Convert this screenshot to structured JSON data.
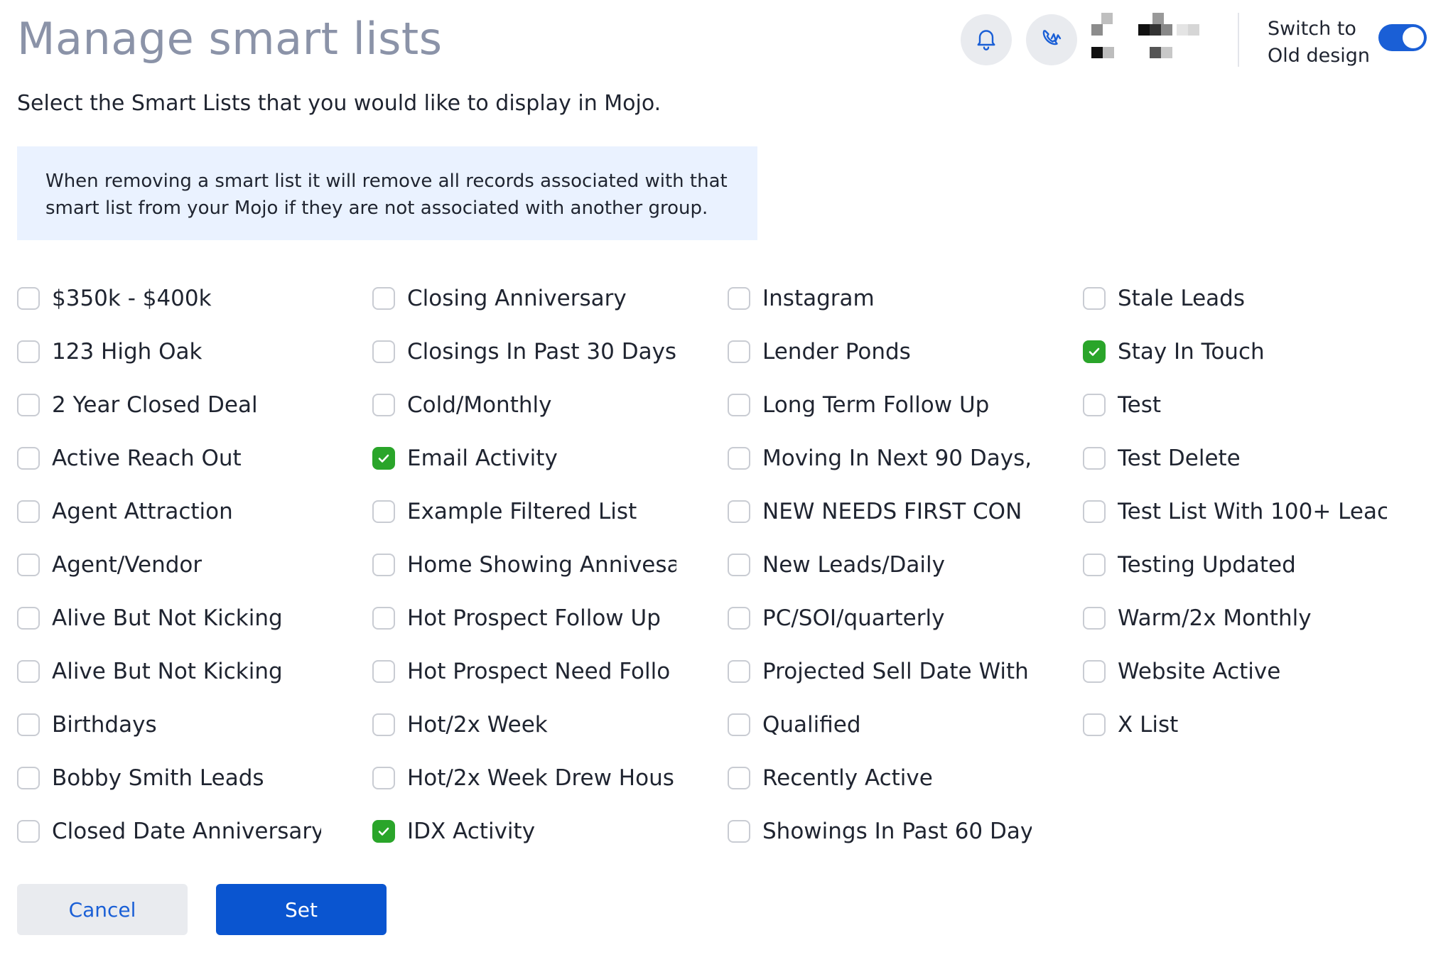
{
  "header": {
    "title": "Manage smart lists",
    "switch_label": "Switch to Old design",
    "toggle_on": true
  },
  "subtitle": "Select the Smart Lists that you would like to display in Mojo.",
  "info_text": "When removing a smart list it will remove all records associated with that smart list from your Mojo if they are not associated with another group.",
  "icons": {
    "bell": "bell-icon",
    "phone": "phone-wave-icon",
    "check": "check-icon"
  },
  "colors": {
    "accent": "#1a5fd6",
    "checked": "#2aa52a",
    "info_bg": "#eaf2ff"
  },
  "lists": {
    "columns": [
      [
        {
          "label": "$350k - $400k",
          "checked": false
        },
        {
          "label": "123 High Oak",
          "checked": false
        },
        {
          "label": "2 Year Closed Deal",
          "checked": false
        },
        {
          "label": "Active Reach Out",
          "checked": false
        },
        {
          "label": "Agent Attraction",
          "checked": false
        },
        {
          "label": "Agent/Vendor",
          "checked": false
        },
        {
          "label": "Alive But Not Kicking",
          "checked": false
        },
        {
          "label": "Alive But Not Kicking",
          "checked": false
        },
        {
          "label": "Birthdays",
          "checked": false
        },
        {
          "label": "Bobby Smith Leads",
          "checked": false
        },
        {
          "label": "Closed Date Anniversary",
          "checked": false
        }
      ],
      [
        {
          "label": "Closing Anniversary",
          "checked": false
        },
        {
          "label": "Closings In Past 30 Days",
          "checked": false
        },
        {
          "label": "Cold/Monthly",
          "checked": false
        },
        {
          "label": "Email Activity",
          "checked": true
        },
        {
          "label": "Example Filtered List",
          "checked": false
        },
        {
          "label": "Home Showing Annivesa",
          "checked": false
        },
        {
          "label": "Hot Prospect Follow Up",
          "checked": false
        },
        {
          "label": "Hot Prospect Need Follo",
          "checked": false
        },
        {
          "label": "Hot/2x Week",
          "checked": false
        },
        {
          "label": "Hot/2x Week Drew Hous",
          "checked": false
        },
        {
          "label": "IDX Activity",
          "checked": true
        }
      ],
      [
        {
          "label": "Instagram",
          "checked": false
        },
        {
          "label": "Lender Ponds",
          "checked": false
        },
        {
          "label": "Long Term Follow Up",
          "checked": false
        },
        {
          "label": "Moving In Next 90 Days,",
          "checked": false
        },
        {
          "label": "NEW NEEDS FIRST CON",
          "checked": false
        },
        {
          "label": "New Leads/Daily",
          "checked": false
        },
        {
          "label": "PC/SOI/quarterly",
          "checked": false
        },
        {
          "label": "Projected Sell Date With",
          "checked": false
        },
        {
          "label": "Qualified",
          "checked": false
        },
        {
          "label": "Recently Active",
          "checked": false
        },
        {
          "label": "Showings In Past 60 Day",
          "checked": false
        }
      ],
      [
        {
          "label": "Stale Leads",
          "checked": false
        },
        {
          "label": "Stay In Touch",
          "checked": true
        },
        {
          "label": "Test",
          "checked": false
        },
        {
          "label": "Test Delete",
          "checked": false
        },
        {
          "label": "Test List With 100+ Leac",
          "checked": false
        },
        {
          "label": "Testing Updated",
          "checked": false
        },
        {
          "label": "Warm/2x Monthly",
          "checked": false
        },
        {
          "label": "Website Active",
          "checked": false
        },
        {
          "label": "X List",
          "checked": false
        }
      ]
    ]
  },
  "buttons": {
    "cancel": "Cancel",
    "set": "Set"
  }
}
